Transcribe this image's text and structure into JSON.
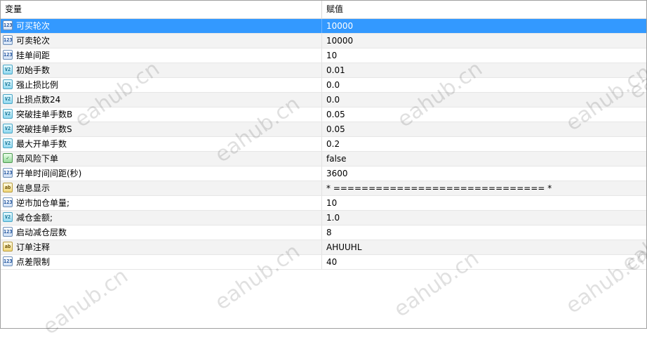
{
  "table": {
    "header_name": "变量",
    "header_value": "赋值",
    "rows": [
      {
        "type": "int",
        "icon_text": "123",
        "name": "可买轮次",
        "value": "10000"
      },
      {
        "type": "int",
        "icon_text": "123",
        "name": "可卖轮次",
        "value": "10000"
      },
      {
        "type": "int",
        "icon_text": "123",
        "name": "挂单间距",
        "value": "10"
      },
      {
        "type": "dbl",
        "icon_text": "V2",
        "name": "初始手数",
        "value": "0.01"
      },
      {
        "type": "dbl",
        "icon_text": "V2",
        "name": "强止损比例",
        "value": "0.0"
      },
      {
        "type": "dbl",
        "icon_text": "V2",
        "name": "止损点数24",
        "value": "0.0"
      },
      {
        "type": "dbl",
        "icon_text": "V2",
        "name": "突破挂单手数B",
        "value": "0.05"
      },
      {
        "type": "dbl",
        "icon_text": "V2",
        "name": "突破挂单手数S",
        "value": "0.05"
      },
      {
        "type": "dbl",
        "icon_text": "V2",
        "name": "最大开单手数",
        "value": "0.2"
      },
      {
        "type": "bool",
        "icon_text": "✓",
        "name": "高风险下单",
        "value": "false"
      },
      {
        "type": "int",
        "icon_text": "123",
        "name": "开单时间间距(秒)",
        "value": "3600"
      },
      {
        "type": "str",
        "icon_text": "ab",
        "name": "信息显示",
        "value": "* ============================== *"
      },
      {
        "type": "int",
        "icon_text": "123",
        "name": "逆市加仓单量;",
        "value": "10"
      },
      {
        "type": "dbl",
        "icon_text": "V2",
        "name": "减仓金额;",
        "value": "1.0"
      },
      {
        "type": "int",
        "icon_text": "123",
        "name": "启动减仓层数",
        "value": "8"
      },
      {
        "type": "str",
        "icon_text": "ab",
        "name": "订单注释",
        "value": "AHUUHL"
      },
      {
        "type": "int",
        "icon_text": "123",
        "name": "点差限制",
        "value": "40"
      }
    ],
    "selected_index": 0
  },
  "watermark_text": "eahub.cn"
}
